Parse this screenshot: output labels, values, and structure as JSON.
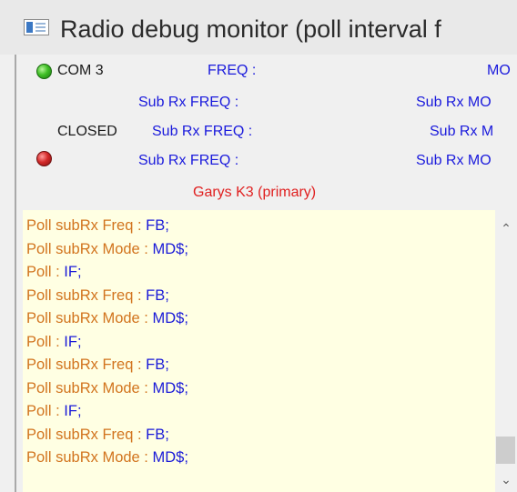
{
  "window": {
    "title": "Radio debug monitor (poll interval f"
  },
  "status": {
    "com_port": "COM 3",
    "freq_label": "FREQ :",
    "mode_label_top": "MO",
    "subrx_freq_1": "Sub Rx FREQ :",
    "subrx_mode_1": "Sub Rx MO",
    "closed_label": "CLOSED",
    "subrx_freq_2": "Sub Rx FREQ :",
    "subrx_mode_2": "Sub Rx M",
    "subrx_freq_3": "Sub Rx FREQ :",
    "subrx_mode_3": "Sub Rx MO",
    "radio_name": "Garys K3 (primary)"
  },
  "log": {
    "lines": [
      {
        "key": "Poll subRx Freq : ",
        "value": "FB;"
      },
      {
        "key": "Poll subRx Mode : ",
        "value": "MD$;"
      },
      {
        "key": "Poll : ",
        "value": "IF;"
      },
      {
        "key": "Poll subRx Freq : ",
        "value": "FB;"
      },
      {
        "key": "Poll subRx Mode : ",
        "value": "MD$;"
      },
      {
        "key": "Poll : ",
        "value": "IF;"
      },
      {
        "key": "Poll subRx Freq : ",
        "value": "FB;"
      },
      {
        "key": "Poll subRx Mode : ",
        "value": "MD$;"
      },
      {
        "key": "Poll : ",
        "value": "IF;"
      },
      {
        "key": "Poll subRx Freq : ",
        "value": "FB;"
      },
      {
        "key": "Poll subRx Mode : ",
        "value": "MD$;"
      }
    ]
  },
  "scrollbar": {
    "up_icon": "chevron-up-icon",
    "down_icon": "chevron-down-icon",
    "position": 0.95
  },
  "colors": {
    "log_background": "#ffffe3",
    "log_key": "#d2741e",
    "log_value": "#1a1ad8",
    "radio_name": "#e02020",
    "status_label": "#1a1adc",
    "led_connected": "#3fbf25",
    "led_closed": "#d42a2a"
  }
}
